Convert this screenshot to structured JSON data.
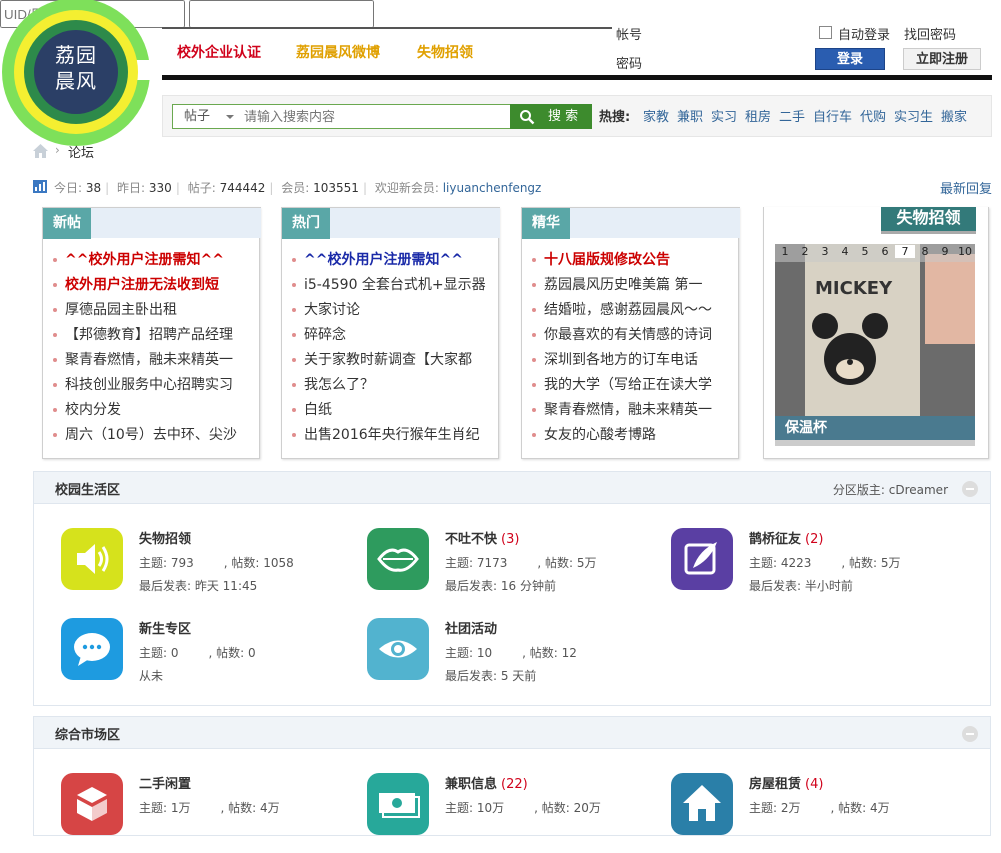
{
  "logo": {
    "text": "荔园晨风",
    "colors": {
      "outer": "#7ee05a",
      "ring": "#f4ef31",
      "inner": "#2d8a4a",
      "center": "#2b3f66"
    }
  },
  "top_nav": [
    "校外企业认证",
    "荔园晨风微博",
    "失物招领"
  ],
  "login": {
    "account_label": "帐号",
    "account_placeholder": "UID/用户名/Email",
    "password_label": "密码",
    "remember_label": "自动登录",
    "forgot_label": "找回密码",
    "login_button": "登录",
    "register_button": "立即注册"
  },
  "search": {
    "type": "帖子",
    "placeholder": "请输入搜索内容",
    "button": "搜 索",
    "hot_label": "热搜:",
    "hot_terms": [
      "家教",
      "兼职",
      "实习",
      "租房",
      "二手",
      "自行车",
      "代购",
      "实习生",
      "搬家"
    ]
  },
  "breadcrumb": {
    "sep": "›",
    "forum": "论坛"
  },
  "stats": {
    "today_label": "今日:",
    "today": "38",
    "yesterday_label": "昨日:",
    "yesterday": "330",
    "posts_label": "帖子:",
    "posts": "744442",
    "members_label": "会员:",
    "members": "103551",
    "welcome_label": "欢迎新会员:",
    "new_member": "liyuanchenfengz",
    "latest_reply": "最新回复"
  },
  "boxes": {
    "new": {
      "tab": "新帖",
      "items": [
        "^^校外用户注册需知^^",
        "校外用户注册无法收到短",
        "厚德品园主卧出租",
        "【邦德教育】招聘产品经理",
        "聚青春燃情，融未来精英一",
        "科技创业服务中心招聘实习",
        "校内分发",
        "周六（10号）去中环、尖沙"
      ]
    },
    "hot": {
      "tab": "热门",
      "items": [
        "^^校外用户注册需知^^",
        "i5-4590 全套台式机+显示器",
        "大家讨论",
        "碎碎念",
        "关于家教时薪调查【大家都",
        "我怎么了？",
        "白纸",
        "出售2016年央行猴年生肖纪"
      ]
    },
    "best": {
      "tab": "精华",
      "items": [
        "十八届版规修改公告",
        "荔园晨风历史唯美篇 第一",
        "结婚啦，感谢荔园晨风～～",
        "你最喜欢的有关情感的诗词",
        "深圳到各地方的订车电话",
        "我的大学（写给正在读大学",
        "聚青春燃情，融未来精英一",
        "女友的心酸考博路"
      ]
    }
  },
  "slider": {
    "tab": "失物招领",
    "numbers": [
      "1",
      "2",
      "3",
      "4",
      "5",
      "6",
      "7",
      "8",
      "9",
      "10"
    ],
    "active_index": 6,
    "caption": "保温杯",
    "image_text": "MICKEY"
  },
  "campus": {
    "title": "校园生活区",
    "moderator": "分区版主: cDreamer",
    "forums": [
      {
        "name": "失物招领",
        "count": "",
        "topics": "主题: 793",
        "posts": "帖数: 1058",
        "last": "最后发表: 昨天 11:45",
        "icon": "speaker-icon",
        "color": "#d6e21c"
      },
      {
        "name": "不吐不快",
        "count": "(3)",
        "topics": "主题: 7173",
        "posts": "帖数: 5万",
        "last": "最后发表: 16 分钟前",
        "icon": "lips-icon",
        "color": "#2e9b5e"
      },
      {
        "name": "鹊桥征友",
        "count": "(2)",
        "topics": "主题: 4223",
        "posts": "帖数: 5万",
        "last": "最后发表: 半小时前",
        "icon": "quill-icon",
        "color": "#5a3fa3"
      },
      {
        "name": "新生专区",
        "count": "",
        "topics": "主题: 0",
        "posts": "帖数: 0",
        "last": "从未",
        "icon": "chat-icon",
        "color": "#1e9be0"
      },
      {
        "name": "社团活动",
        "count": "",
        "topics": "主题: 10",
        "posts": "帖数: 12",
        "last": "最后发表: 5 天前",
        "icon": "eye-icon",
        "color": "#52b3cf"
      }
    ]
  },
  "market": {
    "title": "综合市场区",
    "forums": [
      {
        "name": "二手闲置",
        "count": "",
        "topics": "主题: 1万",
        "posts": "帖数: 4万",
        "last": "",
        "icon": "box-icon",
        "color": "#d64545"
      },
      {
        "name": "兼职信息",
        "count": "(22)",
        "topics": "主题: 10万",
        "posts": "帖数: 20万",
        "last": "",
        "icon": "money-icon",
        "color": "#27a89a"
      },
      {
        "name": "房屋租赁",
        "count": "(4)",
        "topics": "主题: 2万",
        "posts": "帖数: 4万",
        "last": "",
        "icon": "house-icon",
        "color": "#2a7fa8"
      }
    ]
  }
}
